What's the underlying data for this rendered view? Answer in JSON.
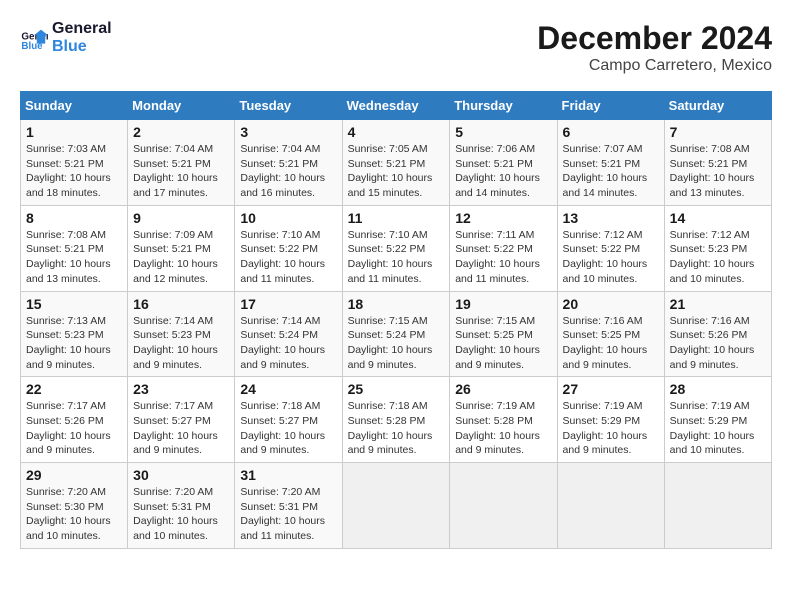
{
  "logo": {
    "line1": "General",
    "line2": "Blue"
  },
  "header": {
    "month": "December 2024",
    "location": "Campo Carretero, Mexico"
  },
  "weekdays": [
    "Sunday",
    "Monday",
    "Tuesday",
    "Wednesday",
    "Thursday",
    "Friday",
    "Saturday"
  ],
  "weeks": [
    [
      {
        "day": 1,
        "sunrise": "7:03 AM",
        "sunset": "5:21 PM",
        "daylight": "10 hours and 18 minutes."
      },
      {
        "day": 2,
        "sunrise": "7:04 AM",
        "sunset": "5:21 PM",
        "daylight": "10 hours and 17 minutes."
      },
      {
        "day": 3,
        "sunrise": "7:04 AM",
        "sunset": "5:21 PM",
        "daylight": "10 hours and 16 minutes."
      },
      {
        "day": 4,
        "sunrise": "7:05 AM",
        "sunset": "5:21 PM",
        "daylight": "10 hours and 15 minutes."
      },
      {
        "day": 5,
        "sunrise": "7:06 AM",
        "sunset": "5:21 PM",
        "daylight": "10 hours and 14 minutes."
      },
      {
        "day": 6,
        "sunrise": "7:07 AM",
        "sunset": "5:21 PM",
        "daylight": "10 hours and 14 minutes."
      },
      {
        "day": 7,
        "sunrise": "7:08 AM",
        "sunset": "5:21 PM",
        "daylight": "10 hours and 13 minutes."
      }
    ],
    [
      {
        "day": 8,
        "sunrise": "7:08 AM",
        "sunset": "5:21 PM",
        "daylight": "10 hours and 13 minutes."
      },
      {
        "day": 9,
        "sunrise": "7:09 AM",
        "sunset": "5:21 PM",
        "daylight": "10 hours and 12 minutes."
      },
      {
        "day": 10,
        "sunrise": "7:10 AM",
        "sunset": "5:22 PM",
        "daylight": "10 hours and 11 minutes."
      },
      {
        "day": 11,
        "sunrise": "7:10 AM",
        "sunset": "5:22 PM",
        "daylight": "10 hours and 11 minutes."
      },
      {
        "day": 12,
        "sunrise": "7:11 AM",
        "sunset": "5:22 PM",
        "daylight": "10 hours and 11 minutes."
      },
      {
        "day": 13,
        "sunrise": "7:12 AM",
        "sunset": "5:22 PM",
        "daylight": "10 hours and 10 minutes."
      },
      {
        "day": 14,
        "sunrise": "7:12 AM",
        "sunset": "5:23 PM",
        "daylight": "10 hours and 10 minutes."
      }
    ],
    [
      {
        "day": 15,
        "sunrise": "7:13 AM",
        "sunset": "5:23 PM",
        "daylight": "10 hours and 9 minutes."
      },
      {
        "day": 16,
        "sunrise": "7:14 AM",
        "sunset": "5:23 PM",
        "daylight": "10 hours and 9 minutes."
      },
      {
        "day": 17,
        "sunrise": "7:14 AM",
        "sunset": "5:24 PM",
        "daylight": "10 hours and 9 minutes."
      },
      {
        "day": 18,
        "sunrise": "7:15 AM",
        "sunset": "5:24 PM",
        "daylight": "10 hours and 9 minutes."
      },
      {
        "day": 19,
        "sunrise": "7:15 AM",
        "sunset": "5:25 PM",
        "daylight": "10 hours and 9 minutes."
      },
      {
        "day": 20,
        "sunrise": "7:16 AM",
        "sunset": "5:25 PM",
        "daylight": "10 hours and 9 minutes."
      },
      {
        "day": 21,
        "sunrise": "7:16 AM",
        "sunset": "5:26 PM",
        "daylight": "10 hours and 9 minutes."
      }
    ],
    [
      {
        "day": 22,
        "sunrise": "7:17 AM",
        "sunset": "5:26 PM",
        "daylight": "10 hours and 9 minutes."
      },
      {
        "day": 23,
        "sunrise": "7:17 AM",
        "sunset": "5:27 PM",
        "daylight": "10 hours and 9 minutes."
      },
      {
        "day": 24,
        "sunrise": "7:18 AM",
        "sunset": "5:27 PM",
        "daylight": "10 hours and 9 minutes."
      },
      {
        "day": 25,
        "sunrise": "7:18 AM",
        "sunset": "5:28 PM",
        "daylight": "10 hours and 9 minutes."
      },
      {
        "day": 26,
        "sunrise": "7:19 AM",
        "sunset": "5:28 PM",
        "daylight": "10 hours and 9 minutes."
      },
      {
        "day": 27,
        "sunrise": "7:19 AM",
        "sunset": "5:29 PM",
        "daylight": "10 hours and 9 minutes."
      },
      {
        "day": 28,
        "sunrise": "7:19 AM",
        "sunset": "5:29 PM",
        "daylight": "10 hours and 10 minutes."
      }
    ],
    [
      {
        "day": 29,
        "sunrise": "7:20 AM",
        "sunset": "5:30 PM",
        "daylight": "10 hours and 10 minutes."
      },
      {
        "day": 30,
        "sunrise": "7:20 AM",
        "sunset": "5:31 PM",
        "daylight": "10 hours and 10 minutes."
      },
      {
        "day": 31,
        "sunrise": "7:20 AM",
        "sunset": "5:31 PM",
        "daylight": "10 hours and 11 minutes."
      },
      null,
      null,
      null,
      null
    ]
  ],
  "labels": {
    "sunrise": "Sunrise:",
    "sunset": "Sunset:",
    "daylight": "Daylight:"
  }
}
